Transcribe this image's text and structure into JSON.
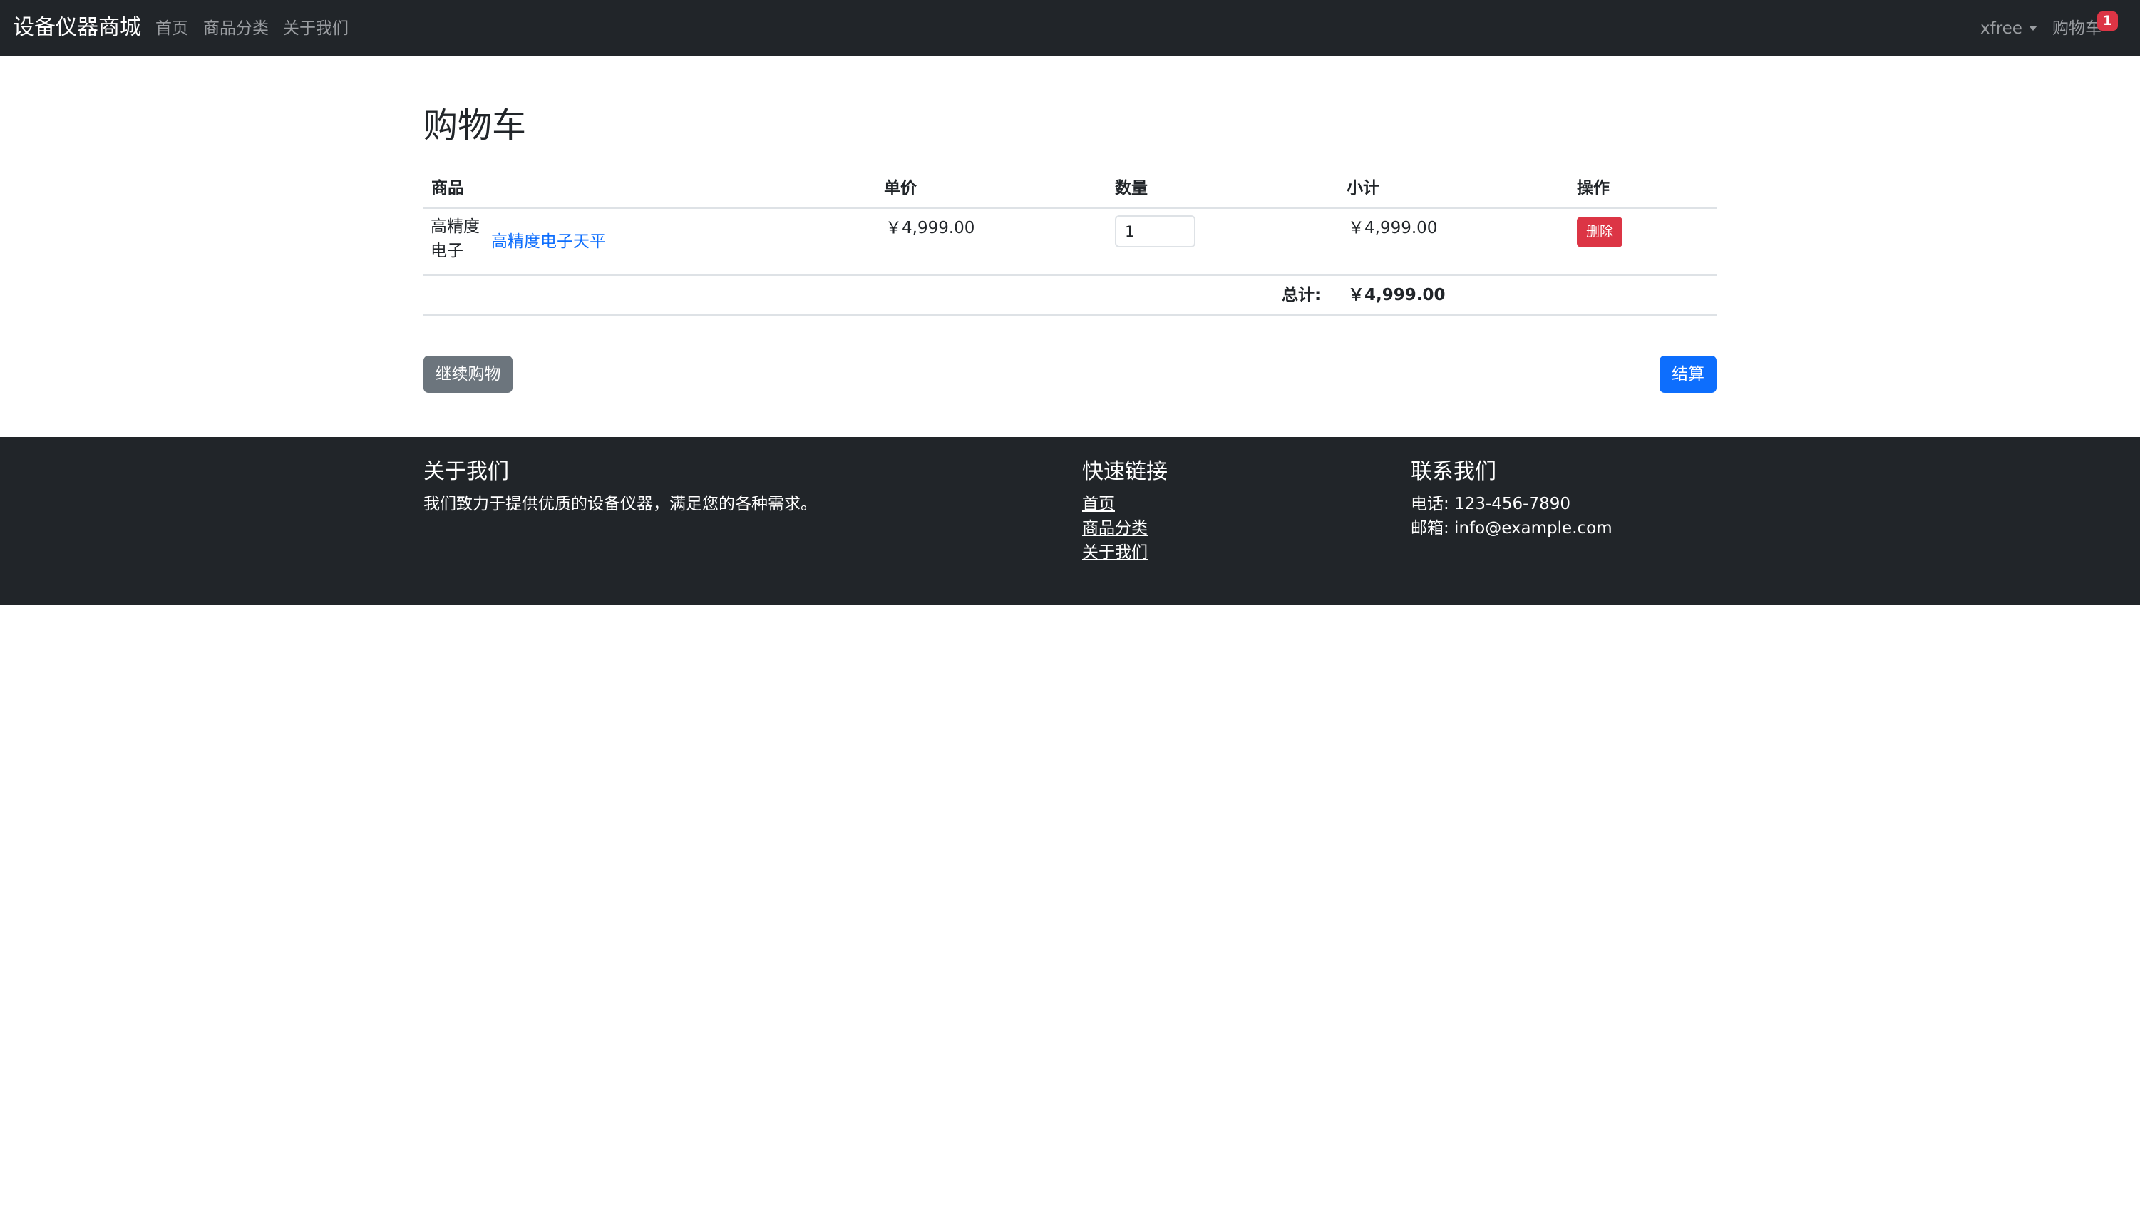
{
  "navbar": {
    "brand": "设备仪器商城",
    "links": [
      "首页",
      "商品分类",
      "关于我们"
    ],
    "user": "xfree",
    "cart_label": "购物车",
    "cart_count": "1"
  },
  "page": {
    "title": "购物车"
  },
  "table": {
    "headers": [
      "商品",
      "单价",
      "数量",
      "小计",
      "操作"
    ],
    "rows": [
      {
        "image_alt": "高精度电子",
        "name": "高精度电子天平",
        "price": "￥4,999.00",
        "quantity": "1",
        "subtotal": "￥4,999.00",
        "delete_label": "删除"
      }
    ],
    "total_label": "总计:",
    "total_value": "￥4,999.00"
  },
  "actions": {
    "continue_label": "继续购物",
    "checkout_label": "结算"
  },
  "footer": {
    "about_title": "关于我们",
    "about_text": "我们致力于提供优质的设备仪器，满足您的各种需求。",
    "links_title": "快速链接",
    "links": [
      "首页",
      "商品分类",
      "关于我们"
    ],
    "contact_title": "联系我们",
    "phone": "电话: 123-456-7890",
    "email": "邮箱: info@example.com"
  },
  "colors": {
    "navbar_bg": "#212529",
    "danger": "#dc3545",
    "primary": "#0d6efd",
    "secondary": "#6c757d"
  }
}
